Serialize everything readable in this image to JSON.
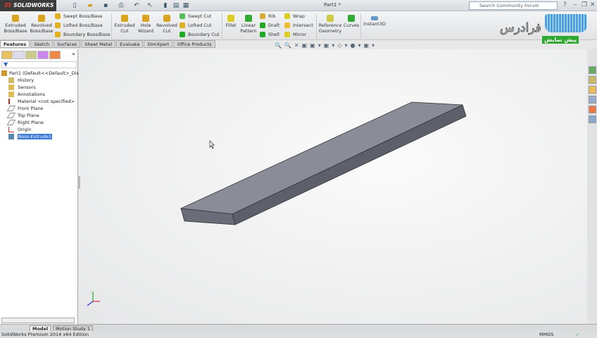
{
  "app": {
    "logo": "SOLIDWORKS",
    "title": "Part1 *",
    "search_placeholder": "Search Community Forum"
  },
  "ribbon": {
    "big": [
      {
        "label": "Extruded Boss/Base",
        "color": "#e0a020"
      },
      {
        "label": "Revolved Boss/Base",
        "color": "#e0a020"
      },
      {
        "label": "Extruded Cut",
        "color": "#e0a020"
      },
      {
        "label": "Hole Wizard",
        "color": "#e0a020"
      },
      {
        "label": "Revolved Cut",
        "color": "#e0a020"
      },
      {
        "label": "Fillet",
        "color": "#e0c020"
      },
      {
        "label": "Linear Pattern",
        "color": "#3a3"
      },
      {
        "label": "Reference Geometry",
        "color": "#cc4"
      },
      {
        "label": "Curves",
        "color": "#3a3"
      },
      {
        "label": "Instant3D",
        "color": "#69c"
      }
    ],
    "small": [
      "Swept Boss/Base",
      "Lofted Boss/Base",
      "Boundary Boss/Base",
      "Swept Cut",
      "Lofted Cut",
      "Boundary Cut",
      "Rib",
      "Draft",
      "Shell",
      "Wrap",
      "Intersect",
      "Mirror"
    ]
  },
  "tabs": [
    "Features",
    "Sketch",
    "Surfaces",
    "Sheet Metal",
    "Evaluate",
    "DimXpert",
    "Office Products"
  ],
  "tree": {
    "root": "Part1  (Default<<Default>_Disp",
    "items": [
      "History",
      "Sensors",
      "Annotations",
      "Material <not specified>",
      "Front Plane",
      "Top Plane",
      "Right Plane",
      "Origin",
      "Boss-Extrude1"
    ]
  },
  "watermark": {
    "brand": "فرادرس",
    "badge": "پیش نمایش"
  },
  "bottom_tabs": [
    "Model",
    "Motion Study 1"
  ],
  "status": {
    "edition": "SolidWorks Premium 2014 x64 Edition",
    "units": "MMGS"
  },
  "colors": {
    "model_top": "#8a8c98",
    "model_side": "#5d5f6a",
    "selection": "#3a78d8"
  }
}
